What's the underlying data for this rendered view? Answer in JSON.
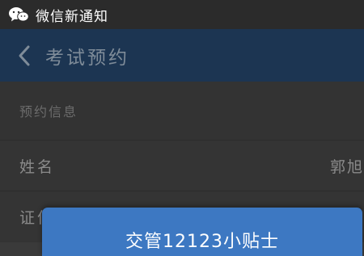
{
  "notification": {
    "icon": "wechat-icon",
    "text": "微信新通知"
  },
  "header": {
    "title": "考试预约",
    "back_icon": "chevron-left-icon"
  },
  "section": {
    "title": "预约信息"
  },
  "form": {
    "name_label": "姓名",
    "name_value": "郭旭",
    "id_label": "证件号码"
  },
  "dialog": {
    "title": "交管12123小贴士"
  },
  "colors": {
    "header": "#1c3552",
    "dialog": "#3d78c2",
    "notification_bar": "#2b2b2b"
  }
}
